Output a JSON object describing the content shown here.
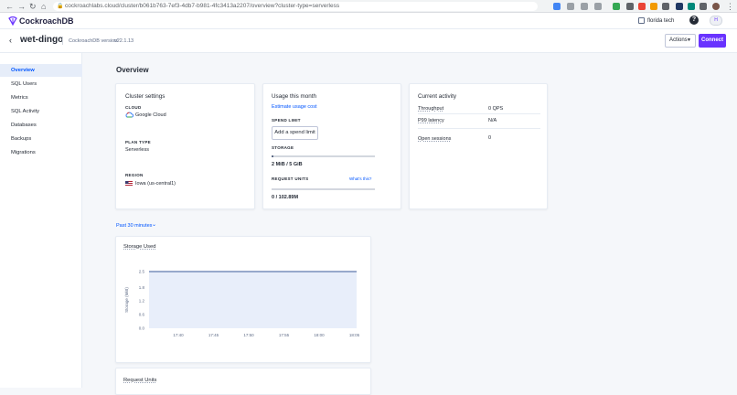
{
  "browser": {
    "url": "cockroachlabs.cloud/cluster/b061b763-7ef3-4db7-b981-4fc3413a2207/overview?cluster-type=serverless"
  },
  "app": {
    "logo_text": "CockroachDB",
    "org_name": "florida tech",
    "help_label": "?",
    "avatar_initials": "H"
  },
  "cluster": {
    "name": "wet-dingo",
    "version_label": "CockroachDB version:",
    "version_value": "v22.1.13",
    "actions_label": "Actions",
    "connect_label": "Connect"
  },
  "sidebar": {
    "items": [
      {
        "label": "Overview",
        "active": true
      },
      {
        "label": "SQL Users",
        "active": false
      },
      {
        "label": "Metrics",
        "active": false
      },
      {
        "label": "SQL Activity",
        "active": false
      },
      {
        "label": "Databases",
        "active": false
      },
      {
        "label": "Backups",
        "active": false
      },
      {
        "label": "Migrations",
        "active": false
      }
    ]
  },
  "main": {
    "title": "Overview",
    "cluster_settings": {
      "title": "Cluster settings",
      "cloud_caption": "CLOUD",
      "cloud_value": "Google Cloud",
      "plan_caption": "PLAN TYPE",
      "plan_value": "Serverless",
      "region_caption": "REGION",
      "region_value": "Iowa (us-central1)"
    },
    "usage": {
      "title": "Usage this month",
      "estimate_link": "Estimate usage cost",
      "spend_caption": "SPEND LIMIT",
      "spend_button": "Add a spend limit",
      "storage_caption": "STORAGE",
      "storage_value": "2 MiB / 5 GiB",
      "storage_fraction": 0.02,
      "request_caption": "REQUEST UNITS",
      "request_link": "What's this?",
      "request_value": "0 / 102.89M",
      "request_fraction": 0.0
    },
    "activity": {
      "title": "Current activity",
      "throughput_label": "Throughput",
      "throughput_value": "0 QPS",
      "latency_label": "P99 latency",
      "latency_value": "N/A",
      "sessions_label": "Open sessions",
      "sessions_value": "0"
    },
    "time_filter": "Past 30 minutes",
    "next_card_title": "Request Units"
  },
  "colors": {
    "accent": "#6933ff",
    "link": "#0055ff",
    "chart_line": "#3a5a9a",
    "chart_fill": "#e8eefa"
  },
  "chart_data": {
    "type": "area",
    "title": "Storage Used",
    "ylabel": "Storage (MiB)",
    "xlabel": "",
    "x": [
      "17:40",
      "17:45",
      "17:50",
      "17:55",
      "18:00",
      "18:05"
    ],
    "y_ticks": [
      "0.0",
      "0.6",
      "1.2",
      "1.8",
      "2.5"
    ],
    "ylim": [
      0,
      2.5
    ],
    "series": [
      {
        "values": [
          2.5,
          2.5,
          2.5,
          2.5,
          2.5,
          2.5
        ]
      }
    ]
  }
}
